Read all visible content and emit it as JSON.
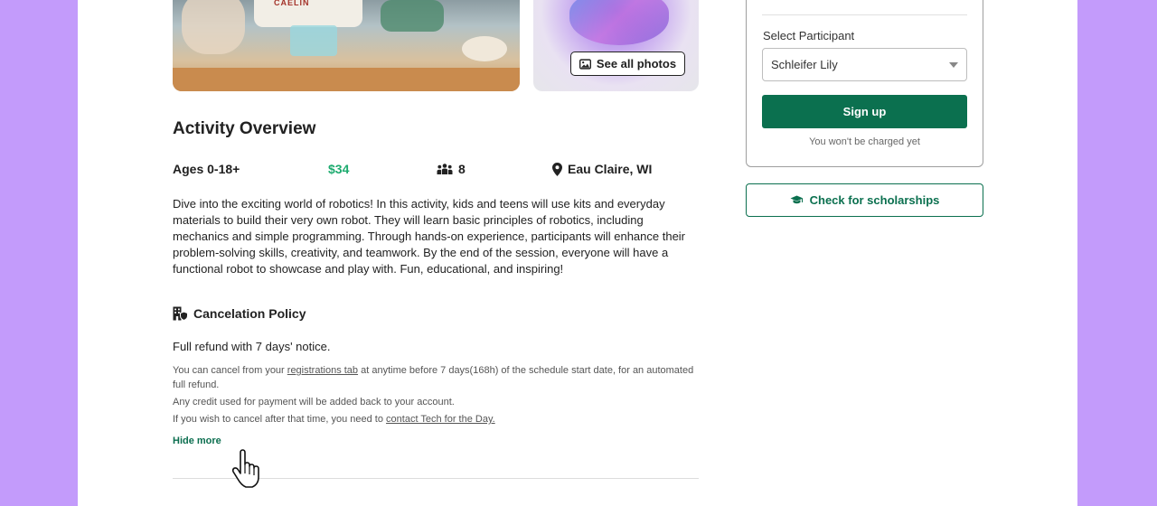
{
  "photos": {
    "see_all_label": "See all photos",
    "apron_text": "CAELIN"
  },
  "overview": {
    "title": "Activity Overview",
    "ages": "Ages 0-18+",
    "price": "$34",
    "group_size": "8",
    "location": "Eau Claire, WI",
    "description": "Dive into the exciting world of robotics! In this activity, kids and teens will use kits and everyday materials to build their very own robot. They will learn basic principles of robotics, including mechanics and simple programming. Through hands-on experience, participants will enhance their problem-solving skills, creativity, and teamwork. By the end of the session, everyone will have a functional robot to showcase and play with. Fun, educational, and inspiring!"
  },
  "policy": {
    "title": "Cancelation Policy",
    "summary": "Full refund with 7 days' notice.",
    "line1_pre": "You can cancel from your ",
    "line1_link": "registrations tab",
    "line1_post": " at anytime before 7 days(168h) of the schedule start date, for an automated full refund.",
    "line2": "Any credit used for payment will be added back to your account.",
    "line3_pre": "If you wish to cancel after that time, you need to ",
    "line3_link": "contact Tech for the Day.",
    "hide_more": "Hide more"
  },
  "signup_card": {
    "select_label": "Select Participant",
    "selected_participant": "Schleifer Lily",
    "signup_label": "Sign up",
    "no_charge_note": "You won't be charged yet"
  },
  "scholarship": {
    "label": "Check for scholarships"
  },
  "colors": {
    "background": "#c39bfb",
    "primary_green": "#0b704f",
    "price_green": "#1dab6f"
  }
}
